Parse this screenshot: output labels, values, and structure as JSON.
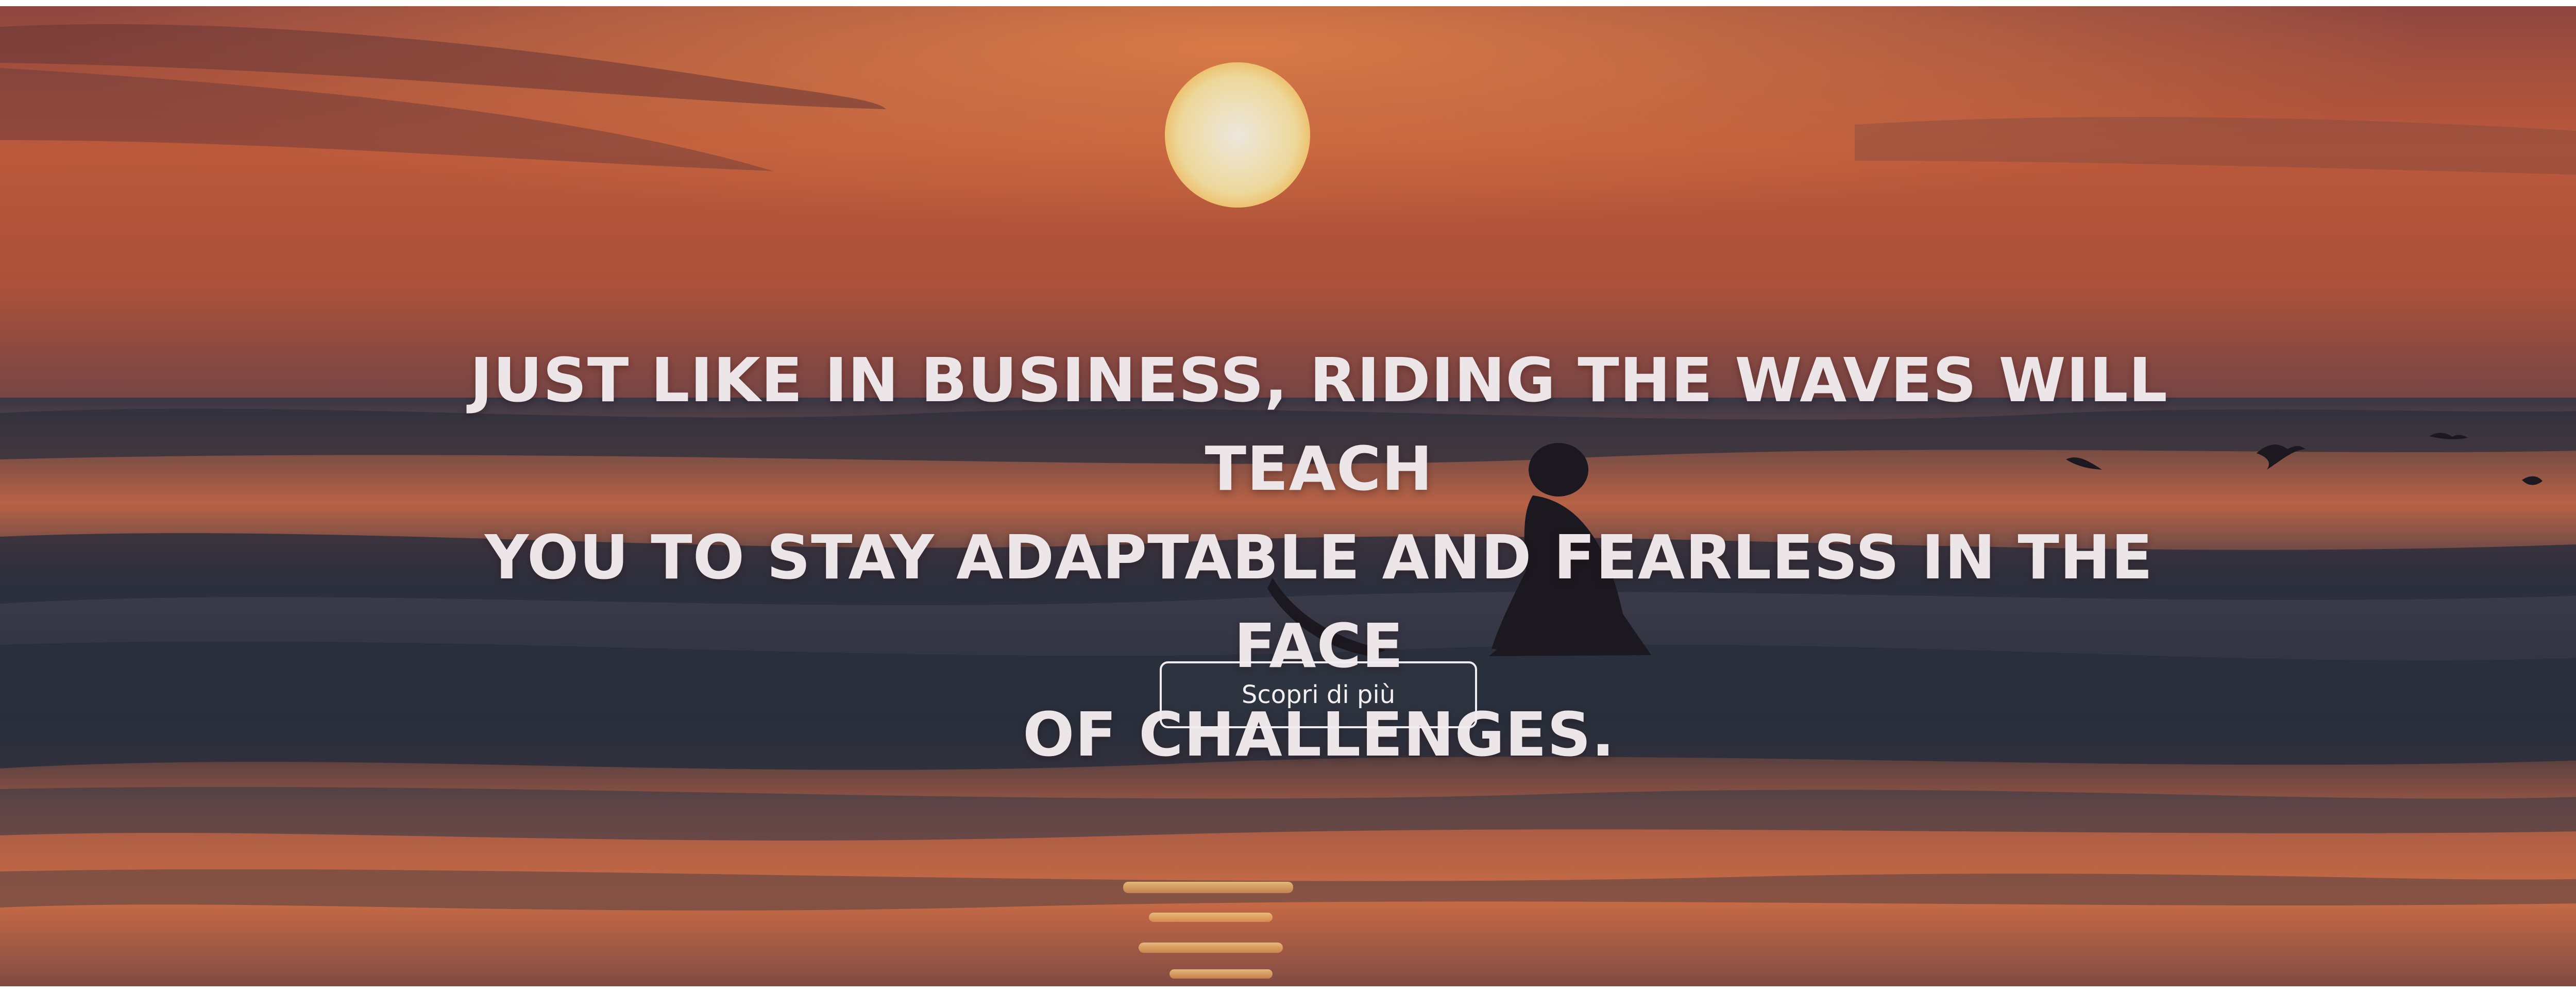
{
  "hero": {
    "headline_lines": [
      "JUST LIKE IN BUSINESS, RIDING THE WAVES WILL TEACH",
      "YOU TO STAY ADAPTABLE AND FEARLESS IN THE FACE",
      "OF CHALLENGES."
    ],
    "cta_label": "Scopri di più"
  },
  "colors": {
    "sky_top": "#8e4a44",
    "sky_mid": "#d8673f",
    "sun": "#fff3d6",
    "sea_dark": "#3a3a4a",
    "sea_reflection": "#e9824a",
    "text": "#ece6e9"
  }
}
